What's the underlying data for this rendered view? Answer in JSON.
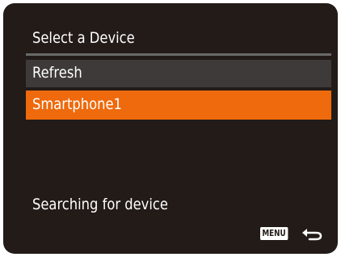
{
  "screen": {
    "title": "Select a Device",
    "items": [
      {
        "label": "Refresh",
        "selected": false
      },
      {
        "label": "Smartphone1",
        "selected": true
      }
    ],
    "status": "Searching for device",
    "footer": {
      "menu_key": "MENU",
      "return_icon": "return-arrow-icon"
    }
  },
  "colors": {
    "background": "#231b18",
    "highlight": "#ee6a0c",
    "unselected_item": "#3d3a39",
    "text": "#ffffff"
  }
}
